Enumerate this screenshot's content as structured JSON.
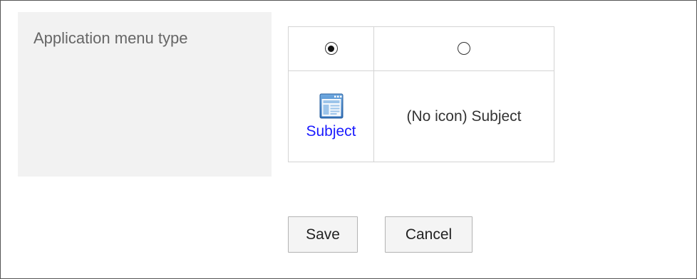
{
  "setting": {
    "label": "Application menu type"
  },
  "options": [
    {
      "selected": true,
      "icon": "application-window-icon",
      "preview_text": "Subject",
      "preview_text_color": "#1a1aff"
    },
    {
      "selected": false,
      "icon": null,
      "preview_text": "(No icon) Subject"
    }
  ],
  "buttons": {
    "save_label": "Save",
    "cancel_label": "Cancel"
  }
}
